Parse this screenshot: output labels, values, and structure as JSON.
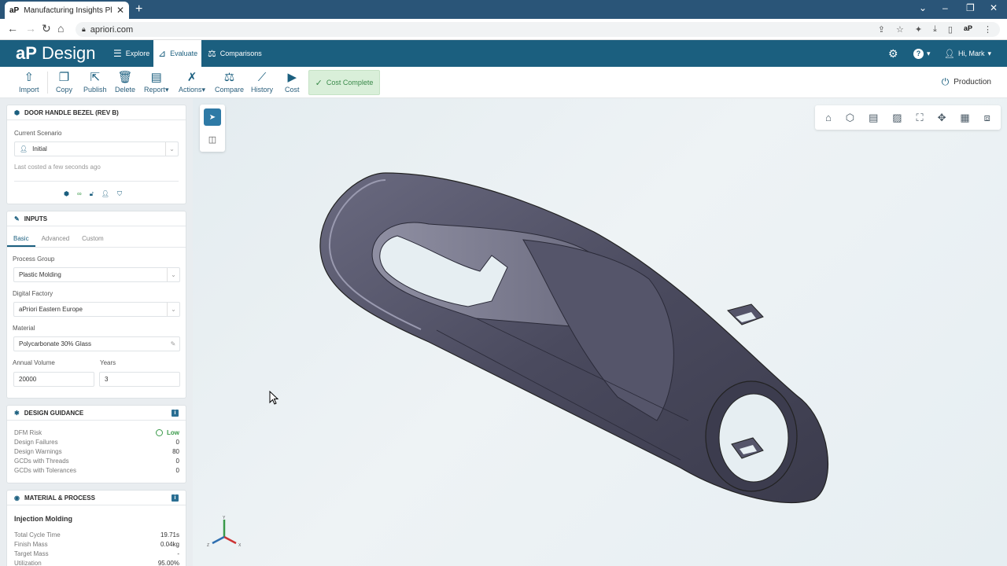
{
  "browser": {
    "tab_title": "Manufacturing Insights Platform",
    "url": "apriori.com",
    "profile_badge": "aP"
  },
  "header": {
    "logo_ap": "aP",
    "logo_text": "Design",
    "nav": [
      {
        "label": "Explore"
      },
      {
        "label": "Evaluate"
      },
      {
        "label": "Comparisons"
      }
    ],
    "help_label": "?",
    "user_label": "Hi, Mark"
  },
  "toolbar": {
    "buttons": [
      {
        "label": "Import"
      },
      {
        "label": "Copy"
      },
      {
        "label": "Publish"
      },
      {
        "label": "Delete"
      },
      {
        "label": "Report"
      },
      {
        "label": "Actions"
      },
      {
        "label": "Compare"
      },
      {
        "label": "History"
      },
      {
        "label": "Cost"
      }
    ],
    "status": "Cost Complete",
    "mode": "Production"
  },
  "part_card": {
    "title": "DOOR HANDLE BEZEL (REV B)",
    "scenario_label": "Current Scenario",
    "scenario_value": "Initial",
    "last_costed": "Last costed a few seconds ago"
  },
  "inputs": {
    "title": "INPUTS",
    "tabs": [
      {
        "label": "Basic"
      },
      {
        "label": "Advanced"
      },
      {
        "label": "Custom"
      }
    ],
    "process_group_label": "Process Group",
    "process_group_value": "Plastic Molding",
    "digital_factory_label": "Digital Factory",
    "digital_factory_value": "aPriori Eastern Europe",
    "material_label": "Material",
    "material_value": "Polycarbonate 30% Glass",
    "annual_volume_label": "Annual Volume",
    "annual_volume_value": "20000",
    "years_label": "Years",
    "years_value": "3"
  },
  "design_guidance": {
    "title": "DESIGN GUIDANCE",
    "rows": [
      {
        "label": "DFM Risk",
        "value": "Low"
      },
      {
        "label": "Design Failures",
        "value": "0"
      },
      {
        "label": "Design Warnings",
        "value": "80"
      },
      {
        "label": "GCDs with Threads",
        "value": "0"
      },
      {
        "label": "GCDs with Tolerances",
        "value": "0"
      }
    ],
    "risk_color": "#3a9a4a"
  },
  "material_process": {
    "title": "MATERIAL & PROCESS",
    "process": "Injection Molding",
    "rows": [
      {
        "label": "Total Cycle Time",
        "value": "19.71s"
      },
      {
        "label": "Finish Mass",
        "value": "0.04kg"
      },
      {
        "label": "Target Mass",
        "value": "-"
      },
      {
        "label": "Utilization",
        "value": "95.00%"
      }
    ]
  },
  "axes": {
    "x": "X",
    "y": "Y",
    "z": "Z"
  },
  "colors": {
    "brand": "#1b5f7f",
    "accent": "#2e7aa6",
    "success_bg": "#d9efd9"
  }
}
